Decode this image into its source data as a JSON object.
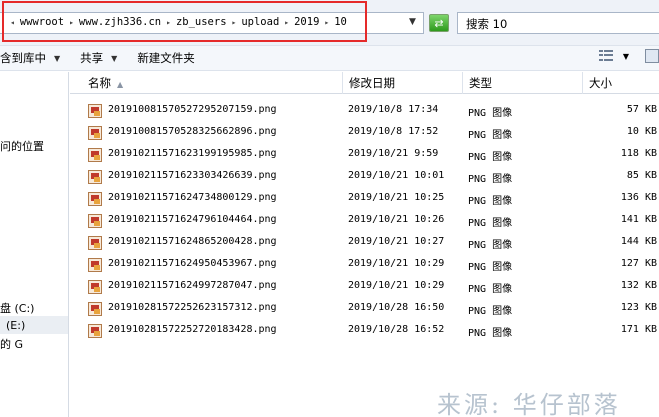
{
  "address": {
    "crumbs": [
      "wwwroot",
      "www.zjh336.cn",
      "zb_users",
      "upload",
      "2019",
      "10"
    ],
    "separator": "▸",
    "dropdown_glyph": "▼"
  },
  "search": {
    "value": "搜索 10"
  },
  "toolbar": {
    "include_library": "含到库中",
    "share": "共享",
    "new_folder": "新建文件夹",
    "caret": "▼"
  },
  "nav": {
    "items": [
      "问的位置",
      "盘 (C:)",
      "(E:)",
      "的 G"
    ]
  },
  "columns": {
    "name": "名称",
    "modified": "修改日期",
    "type": "类型",
    "size": "大小"
  },
  "files": [
    {
      "name": "20191008157052729520 7159.png",
      "date": "2019/10/8 17:34",
      "type": "PNG 图像",
      "size": "57 KB"
    },
    {
      "name": "20191008157052832566 2896.png",
      "date": "2019/10/8 17:52",
      "type": "PNG 图像",
      "size": "10 KB"
    },
    {
      "name": "20191021157162319919 5985.png",
      "date": "2019/10/21 9:59",
      "type": "PNG 图像",
      "size": "118 KB"
    },
    {
      "name": "20191021157162330342 6639.png",
      "date": "2019/10/21 10:01",
      "type": "PNG 图像",
      "size": "85 KB"
    },
    {
      "name": "20191021157162473480 0129.png",
      "date": "2019/10/21 10:25",
      "type": "PNG 图像",
      "size": "136 KB"
    },
    {
      "name": "20191021157162479610 4464.png",
      "date": "2019/10/21 10:26",
      "type": "PNG 图像",
      "size": "141 KB"
    },
    {
      "name": "20191021157162486520 0428.png",
      "date": "2019/10/21 10:27",
      "type": "PNG 图像",
      "size": "144 KB"
    },
    {
      "name": "20191021157162495045 3967.png",
      "date": "2019/10/21 10:29",
      "type": "PNG 图像",
      "size": "127 KB"
    },
    {
      "name": "20191021157162499728 7047.png",
      "date": "2019/10/21 10:29",
      "type": "PNG 图像",
      "size": "132 KB"
    },
    {
      "name": "20191028157225262315 7312.png",
      "date": "2019/10/28 16:50",
      "type": "PNG 图像",
      "size": "123 KB"
    },
    {
      "name": "20191028157225272018 3428.png",
      "date": "2019/10/28 16:52",
      "type": "PNG 图像",
      "size": "171 KB"
    }
  ],
  "watermark": "来源: 华仔部落",
  "colors": {
    "highlight": "#e52a2a",
    "refresh": "#2e9a1c",
    "watermark": "#b7c3cf"
  }
}
